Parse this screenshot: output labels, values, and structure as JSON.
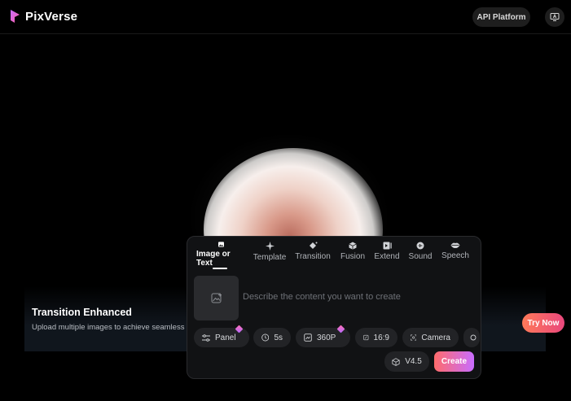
{
  "header": {
    "brand": "PixVerse",
    "api_button": "API Platform",
    "monitor_icon": "monitor-icon"
  },
  "hero": {
    "promo_title": "Transition Enhanced",
    "promo_subtitle": "Upload multiple images to achieve seamless",
    "try_button": "Try Now"
  },
  "panel": {
    "tabs": [
      {
        "label": "Image or Text",
        "icon": "image-icon",
        "active": true
      },
      {
        "label": "Template",
        "icon": "sparkle-icon"
      },
      {
        "label": "Transition",
        "icon": "transition-icon"
      },
      {
        "label": "Fusion",
        "icon": "cube-icon"
      },
      {
        "label": "Extend",
        "icon": "extend-icon"
      },
      {
        "label": "Sound",
        "icon": "sound-icon"
      },
      {
        "label": "Speech",
        "icon": "lips-icon"
      }
    ],
    "prompt_placeholder": "Describe the content you want to create",
    "chips": [
      {
        "label": "Panel",
        "icon": "sliders-icon",
        "premium": true
      },
      {
        "label": "5s",
        "icon": "clock-icon"
      },
      {
        "label": "360P",
        "icon": "resolution-icon",
        "premium": true
      },
      {
        "label": "16:9",
        "icon": "aspect-icon"
      },
      {
        "label": "Camera",
        "icon": "camera-focus-icon"
      }
    ],
    "model_version": "V4.5",
    "create_button": "Create"
  },
  "colors": {
    "background": "#000000",
    "panel_bg": "#111214",
    "chip_bg": "#222326",
    "try_gradient": [
      "#ff7a59",
      "#e9477d"
    ],
    "create_gradient": [
      "#ff6b6b",
      "#c86dff"
    ]
  }
}
